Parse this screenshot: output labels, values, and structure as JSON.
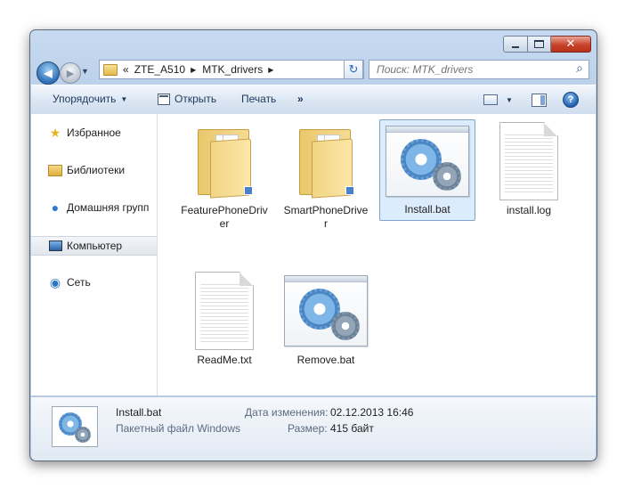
{
  "window": {
    "min_label": "",
    "max_label": "",
    "close_label": "✕"
  },
  "address": {
    "prefix": "«",
    "crumbs": [
      "ZTE_A510",
      "MTK_drivers"
    ]
  },
  "search": {
    "placeholder": "Поиск: MTK_drivers"
  },
  "toolbar": {
    "organize": "Упорядочить",
    "open": "Открыть",
    "print": "Печать",
    "more": "»"
  },
  "sidebar": {
    "items": [
      {
        "label": "Избранное",
        "icon": "star-icon"
      },
      {
        "label": "Библиотеки",
        "icon": "library-icon"
      },
      {
        "label": "Домашняя групп",
        "icon": "homegroup-icon"
      },
      {
        "label": "Компьютер",
        "icon": "computer-icon",
        "selected": true
      },
      {
        "label": "Сеть",
        "icon": "network-icon"
      }
    ]
  },
  "files": [
    {
      "name": "FeaturePhoneDriver",
      "kind": "folder"
    },
    {
      "name": "SmartPhoneDriver",
      "kind": "folder"
    },
    {
      "name": "Install.bat",
      "kind": "bat",
      "selected": true
    },
    {
      "name": "install.log",
      "kind": "doc"
    },
    {
      "name": "ReadMe.txt",
      "kind": "doc"
    },
    {
      "name": "Remove.bat",
      "kind": "bat"
    }
  ],
  "details": {
    "name": "Install.bat",
    "type": "Пакетный файл Windows",
    "modified_label": "Дата изменения:",
    "modified_value": "02.12.2013 16:46",
    "size_label": "Размер:",
    "size_value": "415 байт"
  }
}
